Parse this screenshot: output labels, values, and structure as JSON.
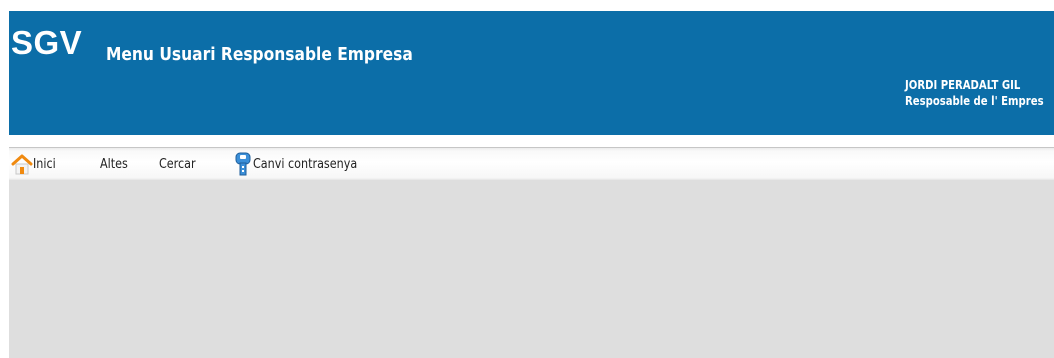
{
  "header": {
    "logo": "SGV",
    "title": "Menu Usuari Responsable Empresa",
    "user_name": "JORDI PERADALT GIL",
    "user_role": "Resposable de l' Empres",
    "background_color": "#0c6ea8"
  },
  "menu": {
    "items": [
      {
        "label": "Inici",
        "icon": "home-icon"
      },
      {
        "label": "Altes",
        "icon": null
      },
      {
        "label": "Cercar",
        "icon": null
      },
      {
        "label": "Canvi contrasenya",
        "icon": "key-icon"
      }
    ]
  },
  "content": {
    "background_color": "#dedede"
  }
}
